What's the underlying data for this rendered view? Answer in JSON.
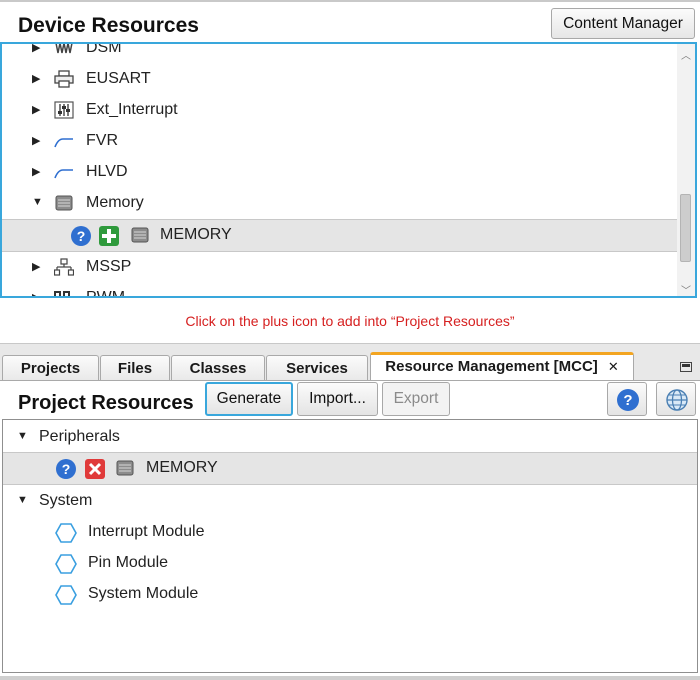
{
  "device_resources": {
    "title": "Device Resources",
    "content_manager_label": "Content Manager",
    "items": [
      {
        "label": "DSM",
        "icon": "dsm-waveform-icon",
        "expanded": false
      },
      {
        "label": "EUSART",
        "icon": "printer-icon",
        "expanded": false
      },
      {
        "label": "Ext_Interrupt",
        "icon": "interrupt-sliders-icon",
        "expanded": false
      },
      {
        "label": "FVR",
        "icon": "voltage-curve-icon",
        "expanded": false
      },
      {
        "label": "HLVD",
        "icon": "voltage-curve-icon",
        "expanded": false
      },
      {
        "label": "Memory",
        "icon": "chip-icon",
        "expanded": true
      },
      {
        "label": "MEMORY",
        "icon": "chip-icon",
        "selected": true
      },
      {
        "label": "MSSP",
        "icon": "network-tree-icon",
        "expanded": false
      },
      {
        "label": "PWM",
        "icon": "pwm-pulse-icon",
        "expanded": false
      }
    ]
  },
  "instruction": "Click on the plus icon to add into “Project Resources”",
  "tabs": [
    {
      "label": "Projects"
    },
    {
      "label": "Files"
    },
    {
      "label": "Classes"
    },
    {
      "label": "Services"
    },
    {
      "label": "Resource Management [MCC]",
      "active": true
    }
  ],
  "project_resources": {
    "title": "Project Resources",
    "buttons": {
      "generate": "Generate",
      "import": "Import...",
      "export": "Export"
    },
    "peripherals_label": "Peripherals",
    "peripheral_item": "MEMORY",
    "system_label": "System",
    "system_items": [
      "Interrupt Module",
      "Pin Module",
      "System Module"
    ]
  },
  "colors": {
    "selection_border": "#39a7dc",
    "active_tab_accent": "#f3a521",
    "instruction_text": "#d62020",
    "help_icon": "#2f6fd0",
    "add_icon": "#2f9a3c",
    "remove_icon": "#e03a3a"
  }
}
